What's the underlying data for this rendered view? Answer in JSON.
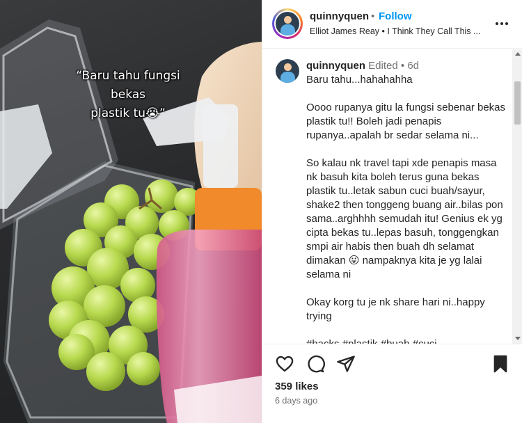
{
  "media": {
    "overlay_line1": "“Baru tahu fungsi bekas",
    "overlay_line2": "plastik tu😭”"
  },
  "header": {
    "username": "quinnyquen",
    "separator": "•",
    "follow_label": "Follow",
    "audio_text": "Elliot James Reay • I Think They Call This ...",
    "more_icon": "more-horizontal-icon"
  },
  "caption": {
    "username": "quinnyquen",
    "edited": "Edited",
    "dot": "•",
    "time": "6d",
    "text": "Baru tahu...hahahahha\n\nOooo rupanya gitu la fungsi sebenar bekas plastik tu!! Boleh jadi penapis rupanya..apalah br sedar selama ni...\n\nSo kalau nk travel tapi xde penapis masa nk basuh kita boleh terus guna bekas plastik tu..letak sabun cuci buah/sayur, shake2 then tonggeng buang air..bilas pon sama..arghhhh semudah itu! Genius ek yg cipta bekas tu..lepas basuh, tonggengkan smpi air habis then buah dh selamat dimakan 😛 nampaknya kita je yg lalai selama ni\n\nOkay korg tu je nk share hari ni..happy trying\n\n#hacks #plastik #buah #cuci"
  },
  "actions": {
    "like_icon": "heart-icon",
    "comment_icon": "comment-icon",
    "share_icon": "share-icon",
    "save_icon": "bookmark-icon",
    "likes": "359 likes",
    "time_ago": "6 days ago"
  },
  "colors": {
    "follow": "#0095f6",
    "muted": "#737373",
    "text": "#262626"
  }
}
